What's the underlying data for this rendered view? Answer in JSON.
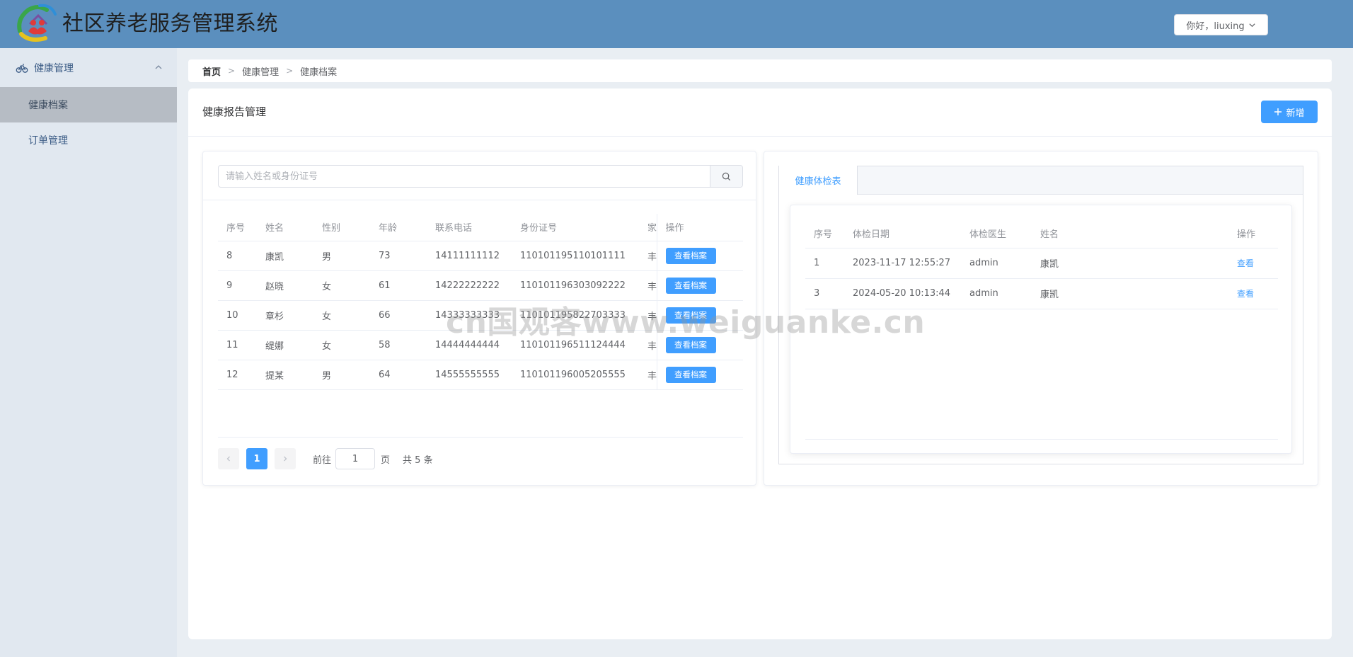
{
  "app": {
    "title": "社区养老服务管理系统"
  },
  "header": {
    "user_greeting": "你好，liuxing"
  },
  "sidebar": {
    "group": {
      "label": "健康管理",
      "expanded": true
    },
    "items": [
      {
        "label": "健康档案",
        "active": true
      },
      {
        "label": "订单管理",
        "active": false
      }
    ]
  },
  "breadcrumb": [
    "首页",
    "健康管理",
    "健康档案"
  ],
  "main": {
    "title": "健康报告管理",
    "add_button": "新增"
  },
  "search": {
    "placeholder": "请输入姓名或身份证号",
    "value": ""
  },
  "elder_table": {
    "columns": [
      "序号",
      "姓名",
      "性别",
      "年龄",
      "联系电话",
      "身份证号",
      "家",
      "操作"
    ],
    "rows": [
      {
        "id": "8",
        "name": "康凯",
        "gender": "男",
        "age": "73",
        "phone": "14111111112",
        "id_card": "110101195110101111",
        "extra": "丰",
        "action": "查看档案"
      },
      {
        "id": "9",
        "name": "赵晓",
        "gender": "女",
        "age": "61",
        "phone": "14222222222",
        "id_card": "110101196303092222",
        "extra": "丰",
        "action": "查看档案"
      },
      {
        "id": "10",
        "name": "章杉",
        "gender": "女",
        "age": "66",
        "phone": "14333333333",
        "id_card": "110101195822703333",
        "extra": "丰",
        "action": "查看档案"
      },
      {
        "id": "11",
        "name": "缇娜",
        "gender": "女",
        "age": "58",
        "phone": "14444444444",
        "id_card": "110101196511124444",
        "extra": "丰",
        "action": "查看档案"
      },
      {
        "id": "12",
        "name": "提某",
        "gender": "男",
        "age": "64",
        "phone": "14555555555",
        "id_card": "110101196005205555",
        "extra": "丰",
        "action": "查看档案"
      }
    ]
  },
  "pagination": {
    "current": "1",
    "goto_label": "前往",
    "goto_value": "1",
    "page_label": "页",
    "total_label": "共 5 条"
  },
  "exam_tabs": {
    "active_tab": "健康体检表"
  },
  "exam_table": {
    "columns": [
      "序号",
      "体检日期",
      "体检医生",
      "姓名",
      "操作"
    ],
    "rows": [
      {
        "id": "1",
        "date": "2023-11-17 12:55:27",
        "doctor": "admin",
        "name": "康凯",
        "action": "查看"
      },
      {
        "id": "3",
        "date": "2024-05-20 10:13:44",
        "doctor": "admin",
        "name": "康凯",
        "action": "查看"
      }
    ]
  },
  "watermark": {
    "text": "cn国观客www.weiguanke.cn"
  },
  "colors": {
    "header_bg": "#5b8fbe",
    "sidebar_bg": "#e1e8f0",
    "primary": "#409eff",
    "active_menu": "#b6bcc4"
  }
}
